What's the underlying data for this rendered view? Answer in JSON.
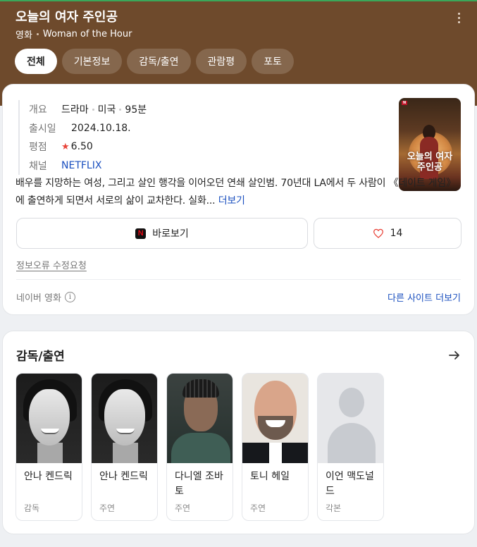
{
  "header": {
    "title": "오늘의 여자 주인공",
    "category": "영화",
    "original_title": "Woman of the Hour",
    "menu_icon": "more-vertical-icon",
    "tabs": [
      {
        "label": "전체",
        "active": true
      },
      {
        "label": "기본정보",
        "active": false
      },
      {
        "label": "감독/출연",
        "active": false
      },
      {
        "label": "관람평",
        "active": false
      },
      {
        "label": "포토",
        "active": false
      }
    ]
  },
  "info": {
    "overview_label": "개요",
    "genre": "드라마",
    "country": "미국",
    "runtime": "95분",
    "release_label": "출시일",
    "release_date": "2024.10.18.",
    "rating_label": "평점",
    "rating": "6.50",
    "channel_label": "채널",
    "channel": "NETFLIX",
    "poster_title": "오늘의 여자 주인공",
    "synopsis": "배우를 지망하는 여성, 그리고 살인 행각을 이어오던 연쇄 살인범. 70년대 LA에서 두 사람이 《데이트 게임》에 출연하게 되면서 서로의 삶이 교차한다. 실화...",
    "more_label": "더보기",
    "watch_label": "바로보기",
    "like_count": "14",
    "report_label": "정보오류 수정요청",
    "source_label": "네이버 영화",
    "other_sites_label": "다른 사이트 더보기",
    "accent_color": "#1a4fbf",
    "rating_color": "#e8443a"
  },
  "cast": {
    "title": "감독/출연",
    "people": [
      {
        "name": "안나 켄드릭",
        "role": "감독"
      },
      {
        "name": "안나 켄드릭",
        "role": "주연"
      },
      {
        "name": "다니엘 조바토",
        "role": "주연"
      },
      {
        "name": "토니 헤일",
        "role": "주연"
      },
      {
        "name": "이언 맥도널드",
        "role": "각본"
      }
    ]
  },
  "colors": {
    "header_bg": "#6e4a2c",
    "card_bg": "#ffffff",
    "page_bg": "#eef0f3"
  }
}
